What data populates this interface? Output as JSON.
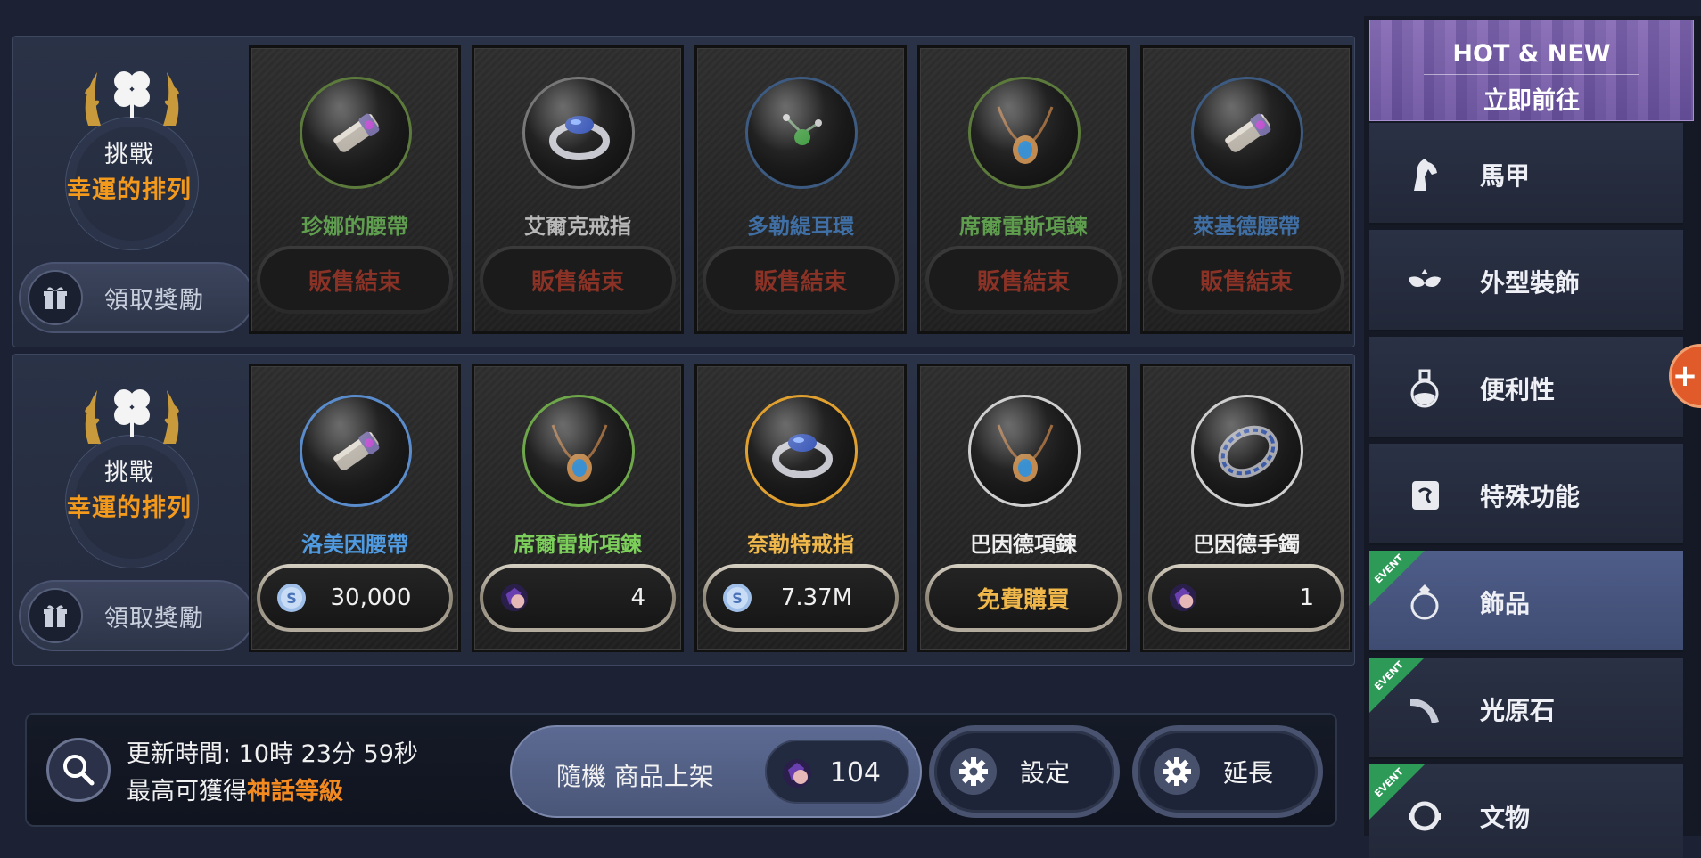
{
  "colors": {
    "accent_orange": "#f39a1c",
    "name_green": "#6fb35a",
    "name_blue": "#4f88c8",
    "name_gold": "#f0b84a",
    "name_white": "#f0f0f0",
    "ended_red": "#8a3226",
    "event_green": "#2e9a58"
  },
  "challenge_rows": [
    {
      "title_line1": "挑戰",
      "title_line2": "幸運的排列",
      "claim_label": "領取獎勵",
      "items": [
        {
          "name": "珍娜的腰帶",
          "name_color": "#5f9e4e",
          "icon": "belt-icon",
          "ring_color": "#5c7a3c",
          "price_type": "ended",
          "price_label": "販售結束"
        },
        {
          "name": "艾爾克戒指",
          "name_color": "#b8b8b8",
          "icon": "ring-icon",
          "ring_color": "#777777",
          "price_type": "ended",
          "price_label": "販售結束"
        },
        {
          "name": "多勒緹耳環",
          "name_color": "#3f6fa5",
          "icon": "earring-icon",
          "ring_color": "#3d5a80",
          "price_type": "ended",
          "price_label": "販售結束"
        },
        {
          "name": "席爾雷斯項鍊",
          "name_color": "#5f9e4e",
          "icon": "necklace-icon",
          "ring_color": "#5c7a3c",
          "price_type": "ended",
          "price_label": "販售結束"
        },
        {
          "name": "萊基德腰帶",
          "name_color": "#3f6fa5",
          "icon": "belt-icon",
          "ring_color": "#3d5a80",
          "price_type": "ended",
          "price_label": "販售結束"
        }
      ]
    },
    {
      "title_line1": "挑戰",
      "title_line2": "幸運的排列",
      "claim_label": "領取獎勵",
      "items": [
        {
          "name": "洛美因腰帶",
          "name_color": "#4f9ae0",
          "icon": "belt-icon",
          "ring_color": "#5a8ccc",
          "price_type": "silver",
          "price_value": "30,000"
        },
        {
          "name": "席爾雷斯項鍊",
          "name_color": "#7ccf5a",
          "icon": "necklace-icon",
          "ring_color": "#6ea64a",
          "price_type": "gem",
          "price_value": "4"
        },
        {
          "name": "奈勒特戒指",
          "name_color": "#f0b84a",
          "icon": "ring-icon",
          "ring_color": "#e0a030",
          "price_type": "silver",
          "price_value": "7.37M"
        },
        {
          "name": "巴因德項鍊",
          "name_color": "#f0f0f0",
          "icon": "necklace-icon",
          "ring_color": "#cfcfcf",
          "price_type": "free",
          "price_label": "免費購買"
        },
        {
          "name": "巴因德手鐲",
          "name_color": "#f0f0f0",
          "icon": "bracelet-icon",
          "ring_color": "#cfcfcf",
          "price_type": "gem",
          "price_value": "1"
        }
      ]
    }
  ],
  "bottom_bar": {
    "update_time": "更新時間: 10時 23分 59秒",
    "max_grade_prefix": "最高可獲得",
    "max_grade_highlight": "神話等級",
    "random_label": "隨機 商品上架",
    "random_count": "104",
    "settings_label": "設定",
    "extend_label": "延長"
  },
  "side_menu": {
    "banner_line1": "HOT & NEW",
    "banner_line2": "立即前往",
    "items": [
      {
        "label": "馬甲",
        "icon": "horse-icon",
        "event": false,
        "active": false
      },
      {
        "label": "外型裝飾",
        "icon": "mask-icon",
        "event": false,
        "active": false
      },
      {
        "label": "便利性",
        "icon": "potion-icon",
        "event": false,
        "active": false
      },
      {
        "label": "特殊功能",
        "icon": "scroll-icon",
        "event": false,
        "active": false
      },
      {
        "label": "飾品",
        "icon": "ring-icon",
        "event": true,
        "active": true
      },
      {
        "label": "光原石",
        "icon": "crystal-icon",
        "event": true,
        "active": false
      },
      {
        "label": "文物",
        "icon": "relic-icon",
        "event": true,
        "active": false
      }
    ],
    "event_tag": "EVENT"
  },
  "float_button_label": "+"
}
